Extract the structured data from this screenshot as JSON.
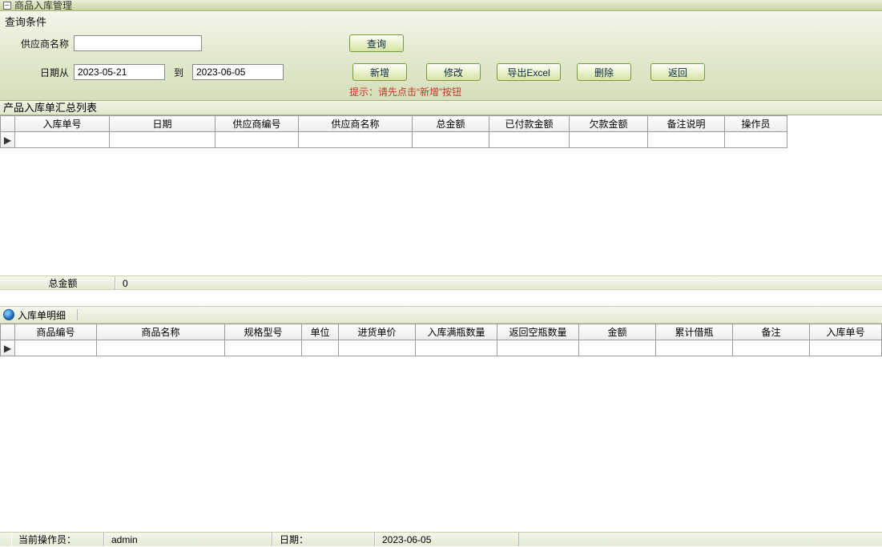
{
  "window": {
    "title": "商品入库管理"
  },
  "query": {
    "section_title": "查询条件",
    "supplier_name_label": "供应商名称",
    "supplier_name_value": "",
    "date_from_label": "日期从",
    "date_from_value": "2023-05-21",
    "date_to_label": "到",
    "date_to_value": "2023-06-05",
    "query_btn": "查询",
    "add_btn": "新增",
    "edit_btn": "修改",
    "export_btn": "导出Excel",
    "delete_btn": "删除",
    "back_btn": "返回",
    "hint": "提示：请先点击“新增”按钮"
  },
  "summary": {
    "title": "产品入库单汇总列表",
    "columns": [
      "入库单号",
      "日期",
      "供应商编号",
      "供应商名称",
      "总金额",
      "已付款金额",
      "欠款金额",
      "备注说明",
      "操作员"
    ],
    "rows": [
      [
        "",
        "",
        "",
        "",
        "",
        "",
        "",
        "",
        ""
      ]
    ]
  },
  "totals": {
    "label": "总金额",
    "value": "0"
  },
  "detail": {
    "title": "入库单明细",
    "columns": [
      "商品编号",
      "商品名称",
      "规格型号",
      "单位",
      "进货单价",
      "入库满瓶数量",
      "返回空瓶数量",
      "金额",
      "累计借瓶",
      "备注",
      "入库单号"
    ],
    "rows": [
      [
        "",
        "",
        "",
        "",
        "",
        "",
        "",
        "",
        "",
        "",
        ""
      ]
    ]
  },
  "status": {
    "operator_label": "当前操作员：",
    "operator_value": "admin",
    "date_label": "日期：",
    "date_value": "2023-06-05"
  }
}
